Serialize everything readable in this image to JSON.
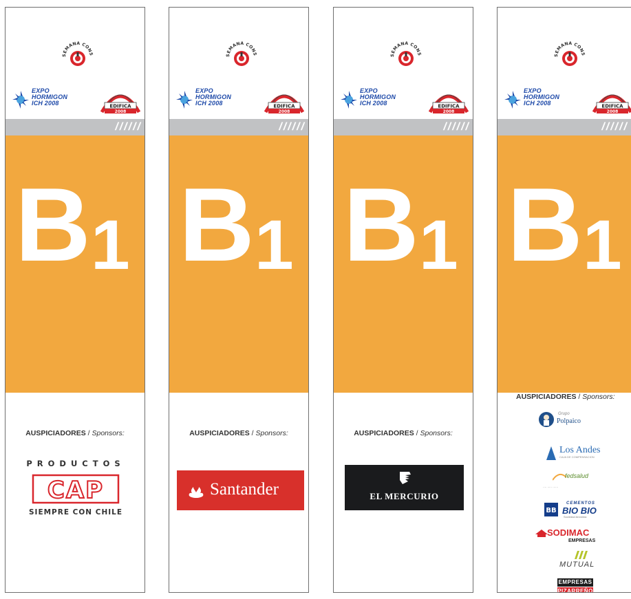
{
  "colors": {
    "orange": "#f2a83f",
    "stripe_grey": "#c1c2c4",
    "expo_blue": "#1c48a8",
    "cap_red": "#d9262c",
    "santander_red": "#d8302b",
    "mercurio_black": "#1a1b1d"
  },
  "header": {
    "seal_text": "SEMANA CONSTRUCCION",
    "expo_lines": [
      "EXPO",
      "HORMIGON",
      "ICH 2008"
    ],
    "edifica_label": "EDIFICA",
    "edifica_year": "2008",
    "stripe_slashes": "//////"
  },
  "panel": {
    "letter": "B",
    "number": "1"
  },
  "sponsors_heading": {
    "bold": "AUSPICIADORES",
    "separator": " / ",
    "italic": "Sponsors:"
  },
  "banners": [
    {
      "id": "b1",
      "sponsor": {
        "top_text": "PRODUCTOS",
        "logo_text": "CAP",
        "bottom_text": "SIEMPRE CON CHILE"
      }
    },
    {
      "id": "b2",
      "sponsor": {
        "name": "Santander"
      }
    },
    {
      "id": "b3",
      "sponsor": {
        "name": "EL MERCURIO"
      }
    },
    {
      "id": "b4",
      "sponsors": {
        "polpaico": {
          "small": "Grupo",
          "name": "Polpaico"
        },
        "losandes": {
          "name": "Los Andes",
          "tag": "CAJA DE COMPENSACION"
        },
        "fedsalud": {
          "name": "fedsalud",
          "row": "····  ·····  ······"
        },
        "biobio": {
          "top": "CEMENTOS",
          "name": "BIO BIO",
          "sub": "Sociedad Anónima"
        },
        "sodimac": {
          "name": "SODIMAC",
          "sub": "EMPRESAS"
        },
        "mutual": {
          "name": "MUTUAL"
        },
        "pizarreno": {
          "top": "EMPRESAS",
          "name": "PIZARREÑO"
        }
      }
    }
  ]
}
